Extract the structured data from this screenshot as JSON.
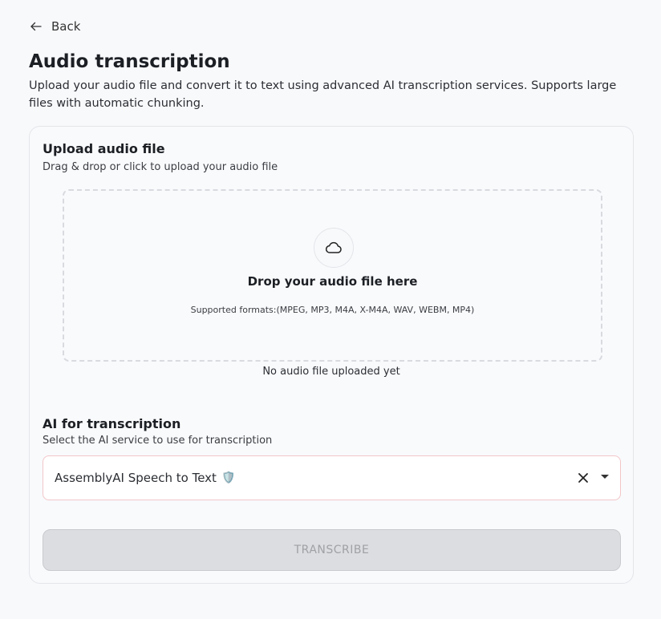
{
  "header": {
    "back_label": "Back",
    "back_icon": "arrow-left-icon",
    "title": "Audio transcription",
    "subtitle": "Upload your audio file and convert it to text using advanced AI transcription services. Supports large files with automatic chunking."
  },
  "upload": {
    "title": "Upload audio file",
    "description": "Drag & drop or click to upload your audio file",
    "dropzone_icon": "cloud-icon",
    "drop_text": "Drop your audio file here",
    "formats": "Supported formats:(MPEG, MP3, M4A, X-M4A, WAV, WEBM, MP4)",
    "status": "No audio file uploaded yet"
  },
  "ai": {
    "title": "AI for transcription",
    "description": "Select the AI service to use for transcription",
    "selected_value": "AssemblyAI Speech to Text",
    "selected_badge": "🛡️"
  },
  "actions": {
    "transcribe_label": "TRANSCRIBE"
  },
  "colors": {
    "background": "#f8f9fb",
    "select_border": "#f2c6c9",
    "button_disabled_bg": "#dcdde0",
    "button_disabled_text": "#9fa1a5"
  }
}
